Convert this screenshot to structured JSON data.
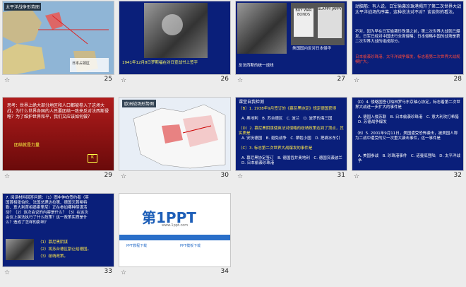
{
  "slides": [
    {
      "num": "25",
      "title": "太平洋战争形势图",
      "legend": "日本占领区"
    },
    {
      "num": "26",
      "caption": "1941年12月8日罗斯福在对日宣战书上签字"
    },
    {
      "num": "27",
      "caption1": "美国国内反对日本侵华",
      "caption2": "反法西斯的统一战线",
      "poster1": "BUY WAR BONDS",
      "poster2": "SLAPPY JAPPY"
    },
    {
      "num": "28",
      "heading": "动脑筋：有人说，日军偷袭珍珠港揭开了第二次世界大战太平洋战场的序幕，这种说法对不对？谈谈你的看法。",
      "body": "不对，因为早在日军偷袭珍珠港之前，第二次世界大战就已爆发，日军已经对中国进行全面侵略；日本侵略中国的战场是第二次世界大战的组成部分。",
      "red": "日本偷袭珍珠港、太平洋战争爆发，标志着第二次世界大战规模扩大。"
    },
    {
      "num": "29",
      "text": "思考：世界上绝大部分地区和人口都被卷入了这场大战，为什么世界各国的人民要团结一致来反对法西斯侵略？为了维护世界和平，我们又应该如何做？",
      "label": "团结就是力量",
      "icon": "K"
    },
    {
      "num": "30",
      "title": "欧洲战场形势图"
    },
    {
      "num": "31",
      "title": "课堂自我检测",
      "q1": "（B）1. 1938年9月签订的《慕尼黑协定》规定德国获得",
      "q1opts": "A. 奥地利　B. 苏台德区　C. 波兰　D. 波罗的海三国",
      "q2": "（D）2. 慕尼黑阴谋使英法对侵略的绥靖政策达到了顶点，其实质是",
      "q2opts": "A. 安抚德国　B. 避免战争　C. 牺牲小国　D. 把祸水东引",
      "q3": "（C）3. 标志第二次世界大战爆发的事件是",
      "q3opts": "A. 慕尼黑协定签订　B. 德国吞并奥地利　C. 德国突袭波兰　D. 日本偷袭珍珠港"
    },
    {
      "num": "32",
      "text": "（D）4. 侵略国签订柏林罗马东京轴心协定，标志着第二次世界大战进一步扩大的事件是",
      "opts": "A. 德国入侵苏联　B. 日本偷袭珍珠港　C. 意大利攻打希腊　D. 苏德战争爆发",
      "q5": "（B）5. 2001年9月11日，美国遭受恐怖袭击，被美国人称为二战中遭受的又一次重大袭击事件，这一事件是",
      "q5opts": "A. 美国参战　B. 珍珠港事件　C. 诺曼底登陆　D. 太平洋战争"
    },
    {
      "num": "33",
      "text": "7. 阅读材料回答问题：（1）图中伸向签约者（英国首相张伯伦、法国总理达拉第、德国元首希特勒、意大利首相墨索里尼）正在参加哪种阴谋活动？（2）这次会议的内容是什么？（3）在这次会议上英法执行了什么政策？这一政策实质是什么？造成了怎样的影响？",
      "answer1": "（1）慕尼黑阴谋",
      "answer2": "（2）将苏台德区割让给德国。",
      "answer3": "（3）绥靖政策。"
    },
    {
      "num": "34",
      "logo": "第1PPT",
      "sub": "www.1ppt.com",
      "b1": "PPT教程下载",
      "b2": "PPT模板下载"
    }
  ]
}
